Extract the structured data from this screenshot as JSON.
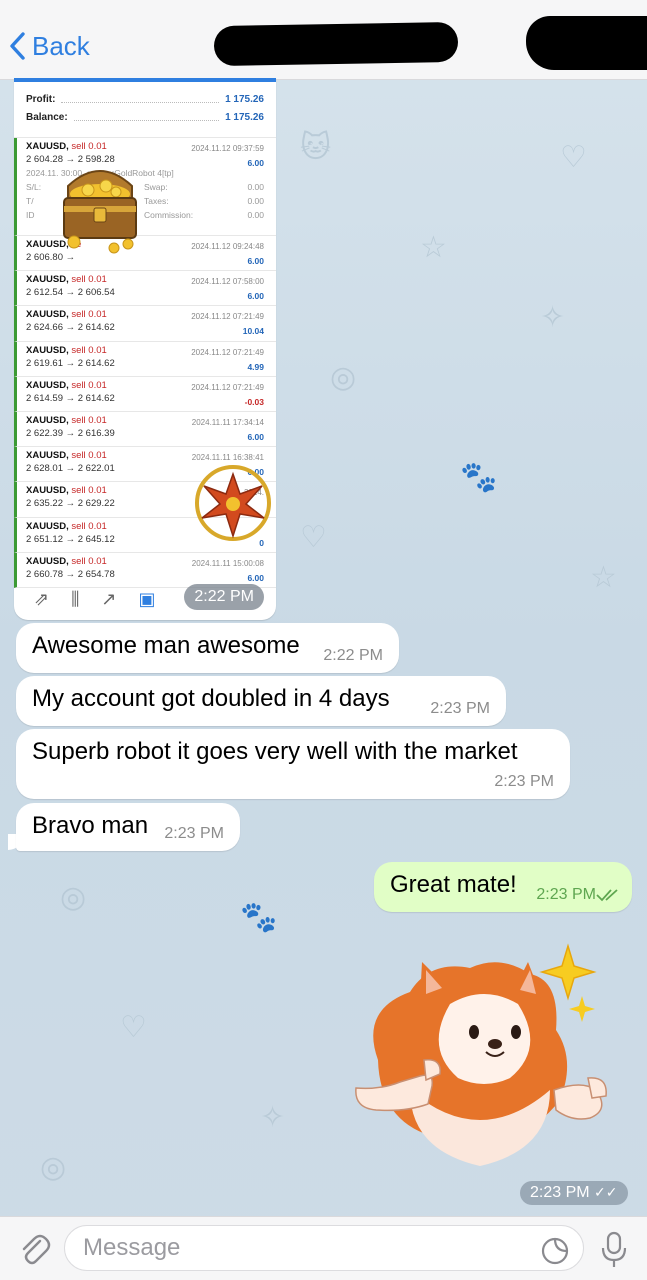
{
  "header": {
    "back_label": "Back"
  },
  "trade_screenshot": {
    "summary": [
      {
        "label": "Profit:",
        "value": "1 175.26"
      },
      {
        "label": "Balance:",
        "value": "1 175.26"
      }
    ],
    "expanded_trade": {
      "symbol": "XAUUSD,",
      "side": "sell 0.01",
      "prices": "2 604.28 → 2 598.28",
      "date": "2024.11.12 09:37:59",
      "profit": "6.00",
      "open_line": "2024.11.   30:00, saviourGoldRobot 4[tp]",
      "details": [
        {
          "label": "S/L:",
          "mid": "Swap:",
          "value": "0.00"
        },
        {
          "label": "T/",
          "mid": "Taxes:",
          "value": "0.00"
        },
        {
          "label": "ID",
          "mid": "Commission:",
          "value": "0.00"
        }
      ]
    },
    "trades": [
      {
        "symbol": "XAUUSD,",
        "side": "se",
        "prices": "2 606.80 →",
        "date": "2024.11.12 09:24:48",
        "profit": "6.00"
      },
      {
        "symbol": "XAUUSD,",
        "side": "sell 0.01",
        "prices": "2 612.54 → 2 606.54",
        "date": "2024.11.12 07:58:00",
        "profit": "6.00"
      },
      {
        "symbol": "XAUUSD,",
        "side": "sell 0.01",
        "prices": "2 624.66 → 2 614.62",
        "date": "2024.11.12 07:21:49",
        "profit": "10.04"
      },
      {
        "symbol": "XAUUSD,",
        "side": "sell 0.01",
        "prices": "2 619.61 → 2 614.62",
        "date": "2024.11.12 07:21:49",
        "profit": "4.99"
      },
      {
        "symbol": "XAUUSD,",
        "side": "sell 0.01",
        "prices": "2 614.59 → 2 614.62",
        "date": "2024.11.12 07:21:49",
        "profit": "-0.03"
      },
      {
        "symbol": "XAUUSD,",
        "side": "sell 0.01",
        "prices": "2 622.39 → 2 616.39",
        "date": "2024.11.11 17:34:14",
        "profit": "6.00"
      },
      {
        "symbol": "XAUUSD,",
        "side": "sell 0.01",
        "prices": "2 628.01 → 2 622.01",
        "date": "2024.11.11 16:38:41",
        "profit": "6.00"
      },
      {
        "symbol": "XAUUSD,",
        "side": "sell 0.01",
        "prices": "2 635.22 → 2 629.22",
        "date": "2024.",
        "profit": ""
      },
      {
        "symbol": "XAUUSD,",
        "side": "sell 0.01",
        "prices": "2 651.12 → 2 645.12",
        "date": "",
        "profit": "0"
      },
      {
        "symbol": "XAUUSD,",
        "side": "sell 0.01",
        "prices": "2 660.78 → 2 654.78",
        "date": "2024.11.11 15:00:08",
        "profit": "6.00"
      }
    ],
    "time": "2:22 PM"
  },
  "messages": [
    {
      "text": "Awesome man awesome",
      "time": "2:22 PM",
      "direction": "in"
    },
    {
      "text": "My account got doubled in 4 days",
      "time": "2:23 PM",
      "direction": "in"
    },
    {
      "text": "Superb robot it goes very well with the market",
      "time": "2:23 PM",
      "direction": "in"
    },
    {
      "text": "Bravo man",
      "time": "2:23 PM",
      "direction": "in"
    },
    {
      "text": "Great mate!",
      "time": "2:23 PM",
      "direction": "out"
    }
  ],
  "sticker": {
    "time": "2:23 PM",
    "icon": "cat-thumbs-up-sticker"
  },
  "input": {
    "placeholder": "Message"
  },
  "colors": {
    "accent": "#2f7fe0",
    "outgoing_bubble": "#e1fec6",
    "incoming_bubble": "#ffffff",
    "chat_background": "#cfdde8"
  }
}
